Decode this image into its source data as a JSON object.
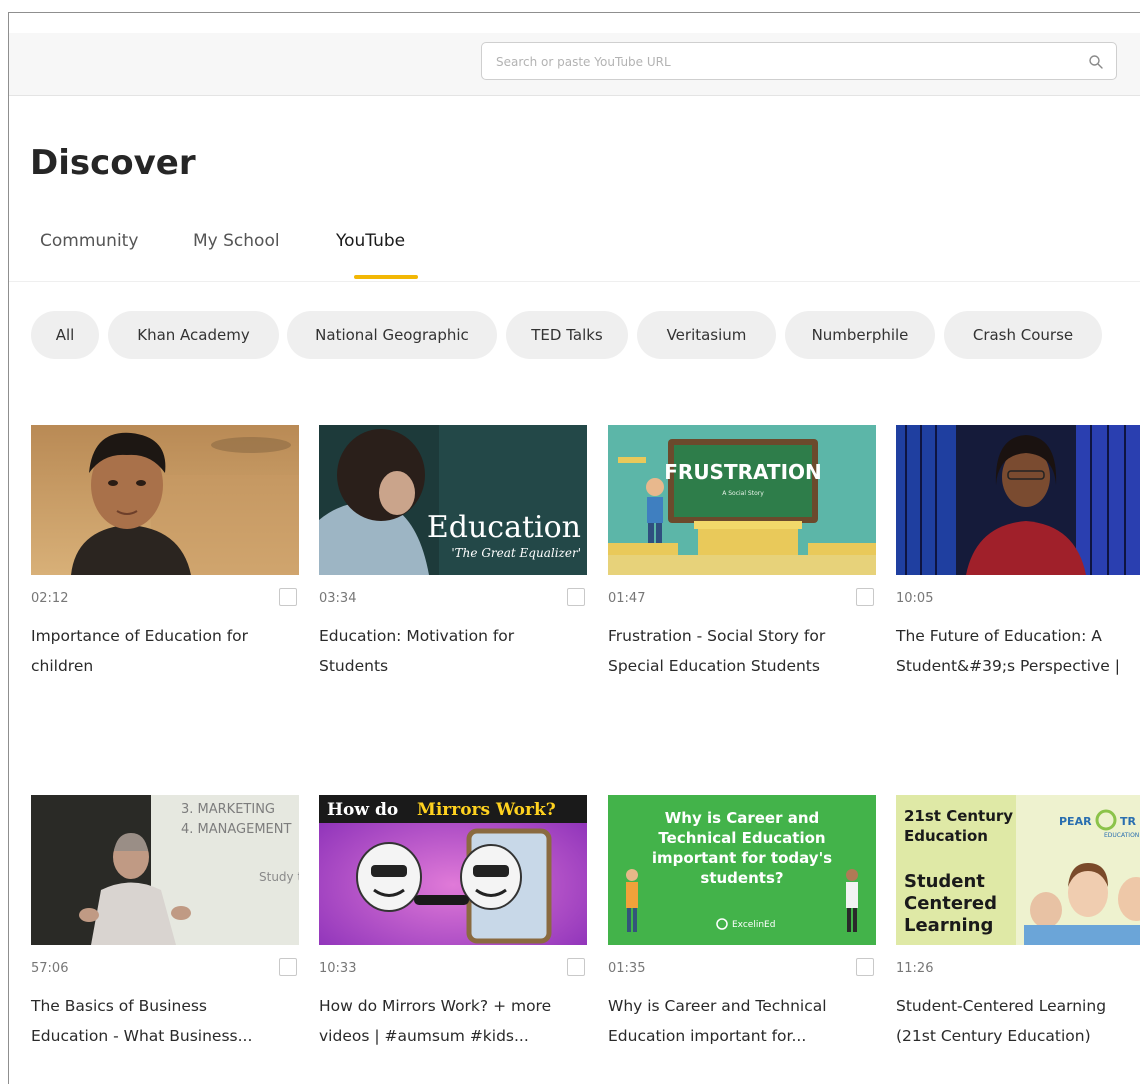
{
  "search": {
    "placeholder": "Search or paste YouTube URL",
    "value": ""
  },
  "page_title": "Discover",
  "tabs": [
    {
      "label": "Community",
      "active": false
    },
    {
      "label": "My School",
      "active": false
    },
    {
      "label": "YouTube",
      "active": true
    }
  ],
  "chips": [
    {
      "label": "All"
    },
    {
      "label": "Khan Academy"
    },
    {
      "label": "National Geographic"
    },
    {
      "label": "TED Talks"
    },
    {
      "label": "Veritasium"
    },
    {
      "label": "Numberphile"
    },
    {
      "label": "Crash Course"
    }
  ],
  "videos": [
    {
      "duration": "02:12",
      "title_line1": "Importance of Education for",
      "title_line2": "children"
    },
    {
      "duration": "03:34",
      "title_line1": "Education: Motivation for",
      "title_line2": "Students",
      "thumb_text1": "Education",
      "thumb_text2": "'The Great Equalizer'"
    },
    {
      "duration": "01:47",
      "title_line1": "Frustration - Social Story for",
      "title_line2": "Special Education Students",
      "thumb_text1": "FRUSTRATION",
      "thumb_text2": "A Social Story"
    },
    {
      "duration": "10:05",
      "title_line1": "The Future of Education: A",
      "title_line2": "Student&#39;s Perspective |"
    },
    {
      "duration": "57:06",
      "title_line1": "The Basics of Business",
      "title_line2": "Education - What Business...",
      "thumb_text1": "3. MARKETING",
      "thumb_text2": "4. MANAGEMENT",
      "thumb_text3": "Study t"
    },
    {
      "duration": "10:33",
      "title_line1": "How do Mirrors Work? + more",
      "title_line2": "videos | #aumsum #kids...",
      "thumb_text1": "How do",
      "thumb_text2": "Mirrors Work?"
    },
    {
      "duration": "01:35",
      "title_line1": "Why is Career and Technical",
      "title_line2": "Education important for...",
      "thumb_text1": "Why is Career and",
      "thumb_text2": "Technical Education",
      "thumb_text3": "important for today's",
      "thumb_text4": "students?",
      "thumb_text5": "ExcelinEd"
    },
    {
      "duration": "11:26",
      "title_line1": "Student-Centered Learning",
      "title_line2": "(21st Century Education)",
      "thumb_text1": "21st Century",
      "thumb_text2": "Education",
      "thumb_text3": "Student",
      "thumb_text4": "Centered",
      "thumb_text5": "Learning",
      "thumb_text6": "PEAR",
      "thumb_text7": "TR",
      "thumb_text8": "EDUCATION"
    }
  ],
  "icons": {
    "search": "search-icon"
  },
  "colors": {
    "accent": "#f2b705",
    "chip_bg": "#efefef",
    "topbar_bg": "#f7f7f7"
  }
}
